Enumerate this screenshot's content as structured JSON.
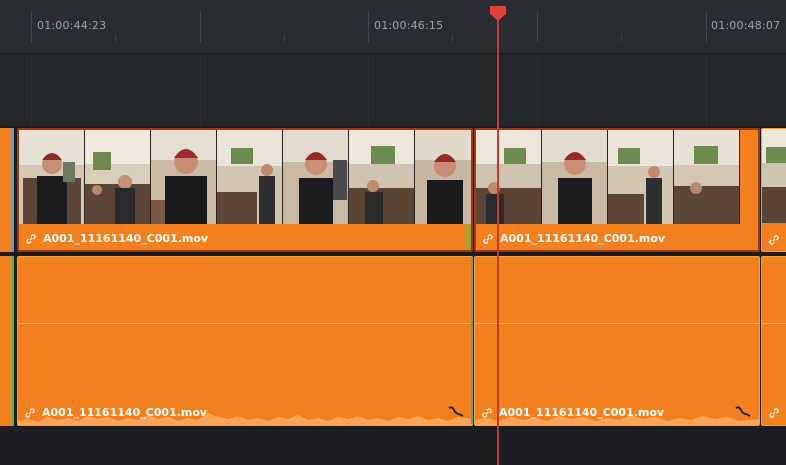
{
  "ruler": {
    "timecodes": [
      "01:00:44:23",
      "01:00:46:15",
      "01:00:48:07"
    ]
  },
  "video_track": {
    "clips": [
      {
        "name": "A001_11161140_C001.mov"
      },
      {
        "name": "A001_11161140_C001.mov"
      }
    ]
  },
  "audio_track": {
    "clips": [
      {
        "name": "A001_11161140_C001.mov"
      },
      {
        "name": "A001_11161140_C001.mov"
      }
    ]
  },
  "colors": {
    "clip": "#f3801f",
    "playhead": "#c5392e",
    "background": "#1e2126"
  },
  "icons": [
    "link-icon",
    "audio-fade-icon",
    "playhead-marker-icon"
  ]
}
